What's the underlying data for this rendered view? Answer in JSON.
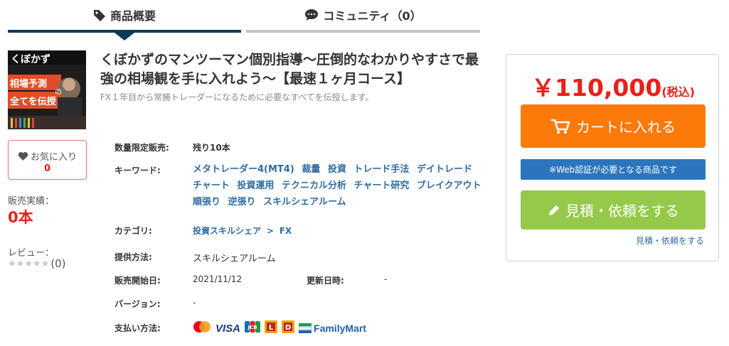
{
  "tabs": [
    {
      "label": "商品概要",
      "icon": "tag-icon"
    },
    {
      "label": "コミュニティ（0）",
      "icon": "chat-icon"
    }
  ],
  "thumbnail": {
    "line1": "くぼかず",
    "line2": "相場予測",
    "line3": "全てを伝授",
    "small": "の"
  },
  "favorite": {
    "label": "お気に入り",
    "count": "0"
  },
  "sales": {
    "label": "販売実績：",
    "value": "0本"
  },
  "review": {
    "label": "レビュー：",
    "stars": "★★★★★",
    "count": "(0)",
    "rating": 0
  },
  "product": {
    "title": "くぼかずのマンツーマン個別指導〜圧倒的なわかりやすさで最強の相場観を手に入れよう〜【最速１ヶ月コース】",
    "subtitle": "FX１年目から常勝トレーダーになるために必要なすべてを伝授します。"
  },
  "details": {
    "limited_label": "数量限定販売:",
    "limited_value": "残り10本",
    "keywords_label": "キーワード:",
    "keywords": [
      "メタトレーダー4(MT4)",
      "裁量",
      "投資",
      "トレード手法",
      "デイトレード",
      "チャート",
      "投資運用",
      "テクニカル分析",
      "チャート研究",
      "ブレイクアウト",
      "順張り",
      "逆張り",
      "スキルシェアルーム"
    ],
    "category_label": "カテゴリ:",
    "category_parent": "投資スキルシェア",
    "category_sep": ">",
    "category_child": "FX",
    "method_label": "提供方法:",
    "method_value": "スキルシェアルーム",
    "start_label": "販売開始日:",
    "start_value": "2021/11/12",
    "update_label": "更新日時:",
    "update_value": "-",
    "version_label": "バージョン:",
    "version_value": "-",
    "payment_label": "支払い方法:",
    "payments": [
      "VISA",
      "JCB",
      "FamilyMart"
    ]
  },
  "purchase": {
    "price_yen": "￥",
    "price_amount": "110,000",
    "price_tax": "(税込)",
    "cart_label": "カートに入れる",
    "web_note": "※Web認証が必要となる商品です",
    "quote_label": "見積・依頼をする",
    "quote_link": "見積・依頼をする"
  },
  "colors": {
    "navy": "#0c3a5b",
    "red": "#e8201a",
    "orange": "#fc7a0a",
    "blue": "#2c75bd",
    "green": "#96c94a",
    "link": "#2e6da4"
  }
}
